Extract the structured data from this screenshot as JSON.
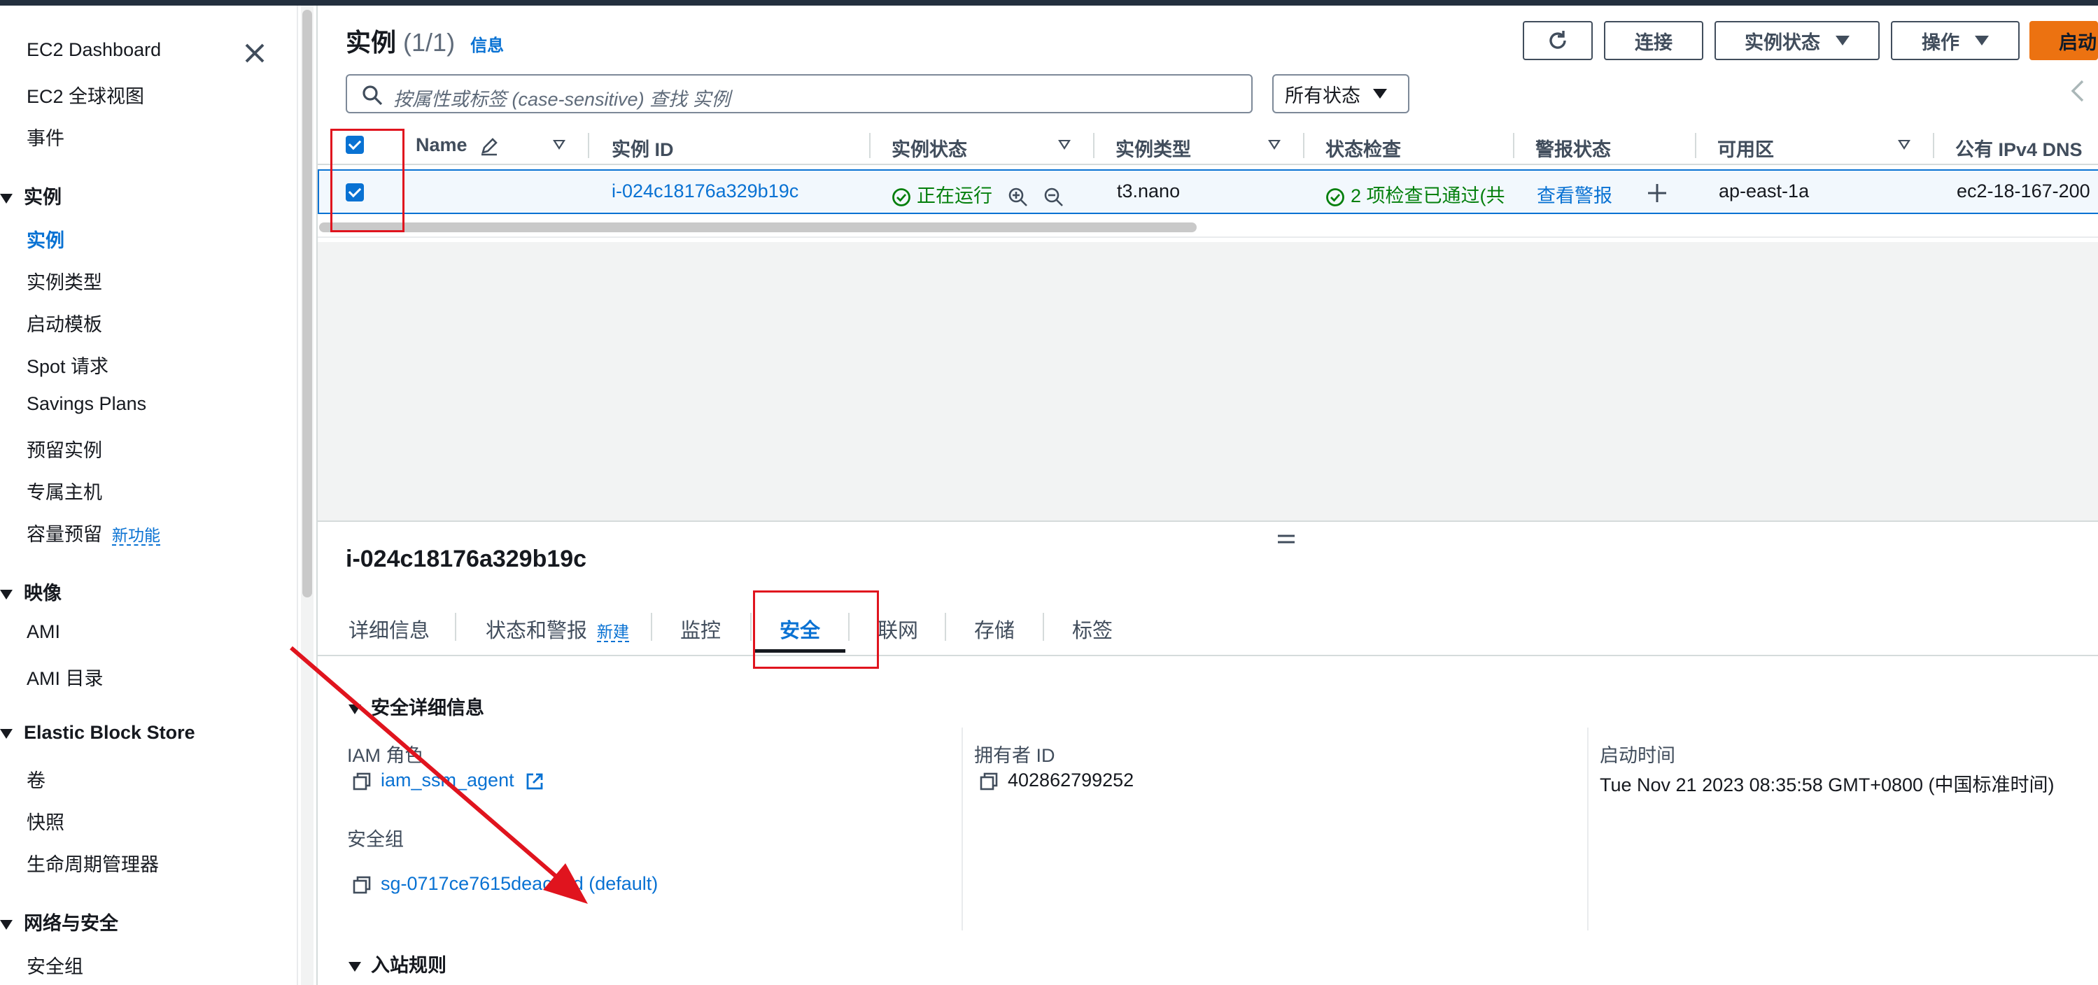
{
  "sidebar": {
    "dashboard": "EC2 Dashboard",
    "global_view": "EC2 全球视图",
    "events": "事件",
    "section_instances": "实例",
    "instances": "实例",
    "instance_types": "实例类型",
    "launch_templates": "启动模板",
    "spot": "Spot 请求",
    "savings_plans": "Savings Plans",
    "reserved": "预留实例",
    "dedicated_hosts": "专属主机",
    "capacity": "容量预留",
    "capacity_new": "新功能",
    "section_images": "映像",
    "ami": "AMI",
    "ami_catalog": "AMI 目录",
    "section_ebs": "Elastic Block Store",
    "volumes": "卷",
    "snapshots": "快照",
    "lifecycle": "生命周期管理器",
    "section_network": "网络与安全",
    "security_groups": "安全组"
  },
  "header": {
    "title": "实例",
    "count": "(1/1)",
    "info": "信息",
    "connect": "连接",
    "instance_state": "实例状态",
    "actions": "操作",
    "launch": "启动"
  },
  "search": {
    "placeholder": "按属性或标签 (case-sensitive) 查找 实例",
    "state_filter": "所有状态"
  },
  "table": {
    "columns": [
      "Name",
      "实例 ID",
      "实例状态",
      "实例类型",
      "状态检查",
      "警报状态",
      "可用区",
      "公有 IPv4 DNS"
    ],
    "row": {
      "name": "",
      "instance_id": "i-024c18176a329b19c",
      "state": "正在运行",
      "type": "t3.nano",
      "status_check": "2 项检查已通过(共",
      "alarm": "查看警报",
      "az": "ap-east-1a",
      "dns": "ec2-18-167-200"
    }
  },
  "detail": {
    "instance_id": "i-024c18176a329b19c",
    "tabs": [
      "详细信息",
      "状态和警报",
      "监控",
      "安全",
      "联网",
      "存储",
      "标签"
    ],
    "tab_new": "新建",
    "active_tab": "安全",
    "security_section": "安全详细信息",
    "iam_role_label": "IAM 角色",
    "iam_role_value": "iam_ssm_agent",
    "owner_label": "拥有者 ID",
    "owner_value": "402862799252",
    "launch_time_label": "启动时间",
    "launch_time_value": "Tue Nov 21 2023 08:35:58 GMT+0800 (中国标准时间)",
    "sg_label": "安全组",
    "sg_value": "sg-0717ce7615deaca7d (default)",
    "inbound_section": "入站规则"
  },
  "colors": {
    "link": "#0972d3",
    "running": "#037f0c",
    "annotation": "#e0141e",
    "launch_button": "#ec7211"
  }
}
